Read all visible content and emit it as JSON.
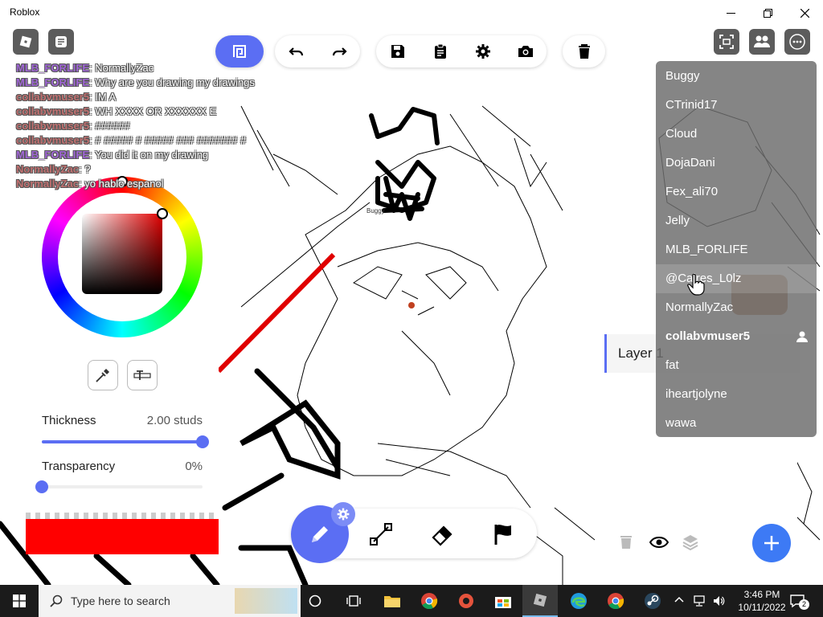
{
  "window": {
    "title": "Roblox"
  },
  "chat": [
    {
      "name": "MLB_FORLIFE",
      "text": ": NormallyZac",
      "color": "#a066d6"
    },
    {
      "name": "MLB_FORLIFE",
      "text": ": Why are you drawing my drawings",
      "color": "#a066d6"
    },
    {
      "name": "collabvmuser5",
      "text": ": IM A",
      "color": "#c07070"
    },
    {
      "name": "collabvmuser5",
      "text": ": WH XXXX OR XXXXXX E",
      "color": "#c07070"
    },
    {
      "name": "collabvmuser5",
      "text": ": ######",
      "color": "#c07070"
    },
    {
      "name": "collabvmuser5",
      "text": ": # ##### # ##### ### ####### #",
      "color": "#c07070"
    },
    {
      "name": "MLB_FORLIFE",
      "text": ": You did it on my drawing",
      "color": "#a066d6"
    },
    {
      "name": "NormallyZac",
      "text": ": ?",
      "color": "#c07070"
    },
    {
      "name": "NormallyZac",
      "text": ": yo hablo espanol",
      "color": "#c07070"
    }
  ],
  "panel": {
    "thickness_label": "Thickness",
    "thickness_value": "2.00 studs",
    "thickness_level": 1.0,
    "transparency_label": "Transparency",
    "transparency_value": "0%",
    "transparency_level": 0.0,
    "current_color": "#ff0000"
  },
  "players": {
    "items": [
      "Buggy",
      "CTrinid17",
      "Cloud",
      "DojaDani",
      "Fex_ali70",
      "Jelly",
      "MLB_FORLIFE",
      "@Caires_L0lz",
      "NormallyZac",
      "collabvmuser5",
      "fat",
      "iheartjolyne",
      "wawa"
    ],
    "current_user": "collabvmuser5",
    "hovered": "@Caires_L0lz"
  },
  "layers": {
    "items": [
      "Layer 1"
    ]
  },
  "canvas_tag": "Buggy",
  "taskbar": {
    "search_placeholder": "Type here to search",
    "time": "3:46 PM",
    "date": "10/11/2022",
    "notifications": "2"
  },
  "colors": {
    "accent": "#5b6ef3",
    "taskbar": "#1b1b1b"
  }
}
